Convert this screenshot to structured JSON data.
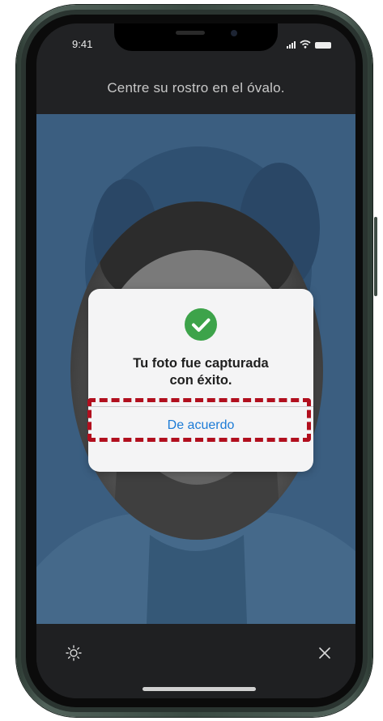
{
  "status_bar": {
    "time": "9:41"
  },
  "camera_screen": {
    "instruction": "Centre su rostro en el óvalo."
  },
  "dialog": {
    "message_line1": "Tu foto fue capturada",
    "message_line2": "con éxito.",
    "button_label": "De acuerdo",
    "icon": "checkmark-circle-icon"
  },
  "bottom_bar": {
    "left_icon": "brightness-icon",
    "right_icon": "close-icon"
  },
  "colors": {
    "accent_blue": "#1c7bd6",
    "success_green": "#3da34a",
    "camera_tint": "#3b5e80",
    "highlight_red": "#b10f1e"
  }
}
